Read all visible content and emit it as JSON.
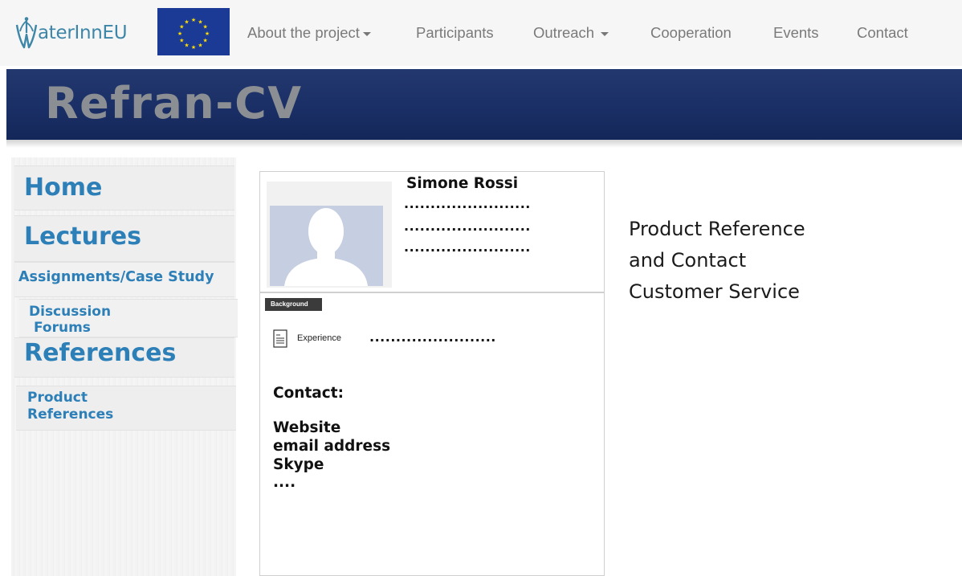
{
  "logo": {
    "text": "aterInnEU",
    "flag_color": "#1a3a95",
    "star_color": "#ffdd00",
    "text_color": "#3d86a8"
  },
  "nav": {
    "about": "About the project",
    "participants": "Participants",
    "outreach": "Outreach",
    "cooperation": "Cooperation",
    "events": "Events",
    "contact": "Contact"
  },
  "banner": {
    "title": "Refran-CV",
    "bg_color": "#1a2f66"
  },
  "sidebar": {
    "home": "Home",
    "lectures": "Lectures",
    "assignments": "Assignments/Case Study",
    "discussion_line1": "Discussion",
    "discussion_line2": "Forums",
    "references": "References",
    "product_refs_line1": "Product",
    "product_refs_line2": "References",
    "link_color": "#2d7fb8"
  },
  "cv": {
    "name": "Simone Rossi",
    "dots1": "........................",
    "dots2": "........................",
    "dots3": "........................",
    "background_label": "Background",
    "experience_label": "Experience",
    "experience_dots": "........................",
    "contact_heading": "Contact:",
    "website": "Website",
    "email": "email address",
    "skype": "Skype",
    "more": "...."
  },
  "side_text": {
    "line1": "Product Reference",
    "line2": "and Contact",
    "line3": "Customer Service"
  }
}
